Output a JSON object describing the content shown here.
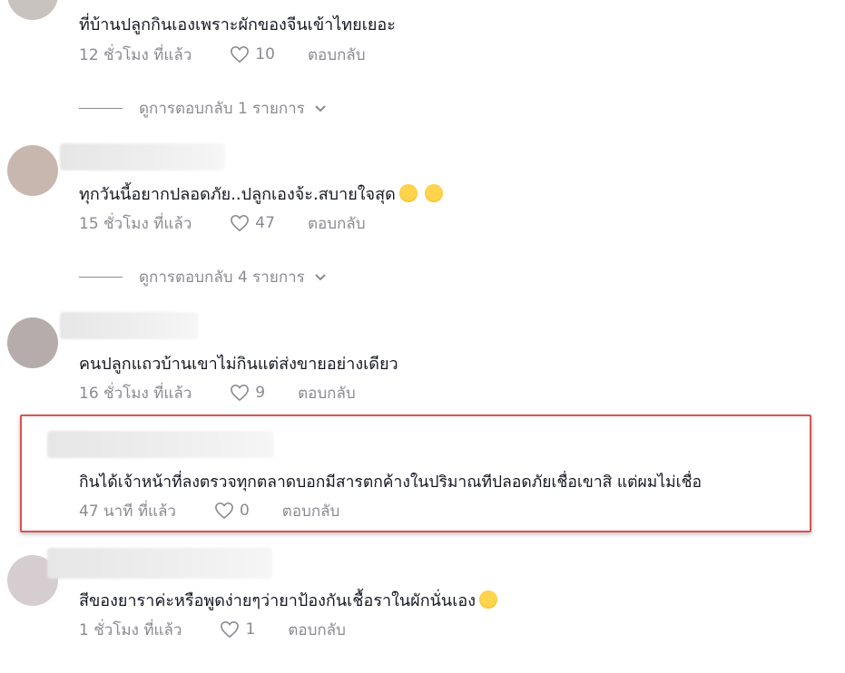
{
  "comments": [
    {
      "text": "ที่บ้านปลูกกินเองเพราะผักของจีนเข้าไทยเยอะ",
      "time": "12 ชั่วโมง ที่แล้ว",
      "likes": "10",
      "reply": "ตอบกลับ",
      "view_replies": "ดูการตอบกลับ 1 รายการ"
    },
    {
      "text": "ทุกวันนี้อยากปลอดภัย..ปลูกเองจ้ะ.สบายใจสุด",
      "emojis": [
        "rofl-face-icon",
        "rofl-face-icon"
      ],
      "time": "15 ชั่วโมง ที่แล้ว",
      "likes": "47",
      "reply": "ตอบกลับ",
      "view_replies": "ดูการตอบกลับ 4 รายการ"
    },
    {
      "text": "คนปลูกแถวบ้านเขาไม่กินแต่ส่งขายอย่างเดียว",
      "time": "16 ชั่วโมง ที่แล้ว",
      "likes": "9",
      "reply": "ตอบกลับ"
    },
    {
      "text": "กินได้เจ้าหน้าที่ลงตรวจทุกตลาดบอกมีสารตกค้างในปริมาณทีปลอดภัยเชื่อเขาสิ แต่ผมไม่เชื่อ",
      "time": "47 นาที ที่แล้ว",
      "likes": "0",
      "reply": "ตอบกลับ",
      "highlighted": true,
      "highlight_color": "#d9534f"
    },
    {
      "text": "สีของยาราค่ะหรือพูดง่ายๆว่ายาป้องกันเชื้อราในผักนั่นเอง",
      "emojis": [
        "sweat-smile-icon"
      ],
      "time": "1 ชั่วโมง ที่แล้ว",
      "likes": "1",
      "reply": "ตอบกลับ"
    }
  ],
  "colors": {
    "text": "#161823",
    "meta": "#8a8b91",
    "highlight": "#d9534f"
  }
}
